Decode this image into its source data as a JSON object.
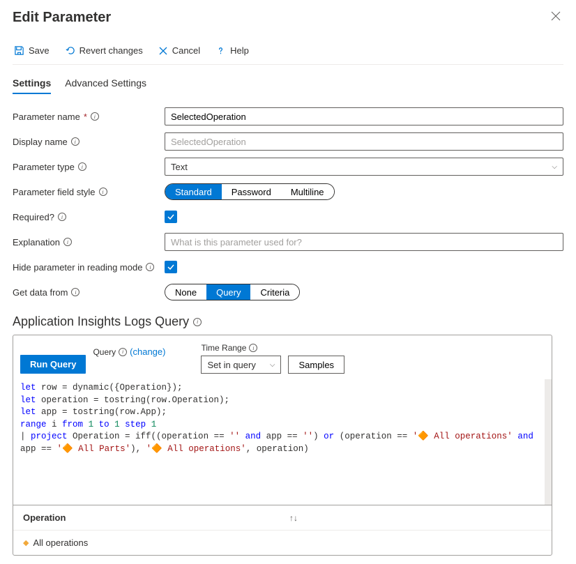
{
  "header": {
    "title": "Edit Parameter"
  },
  "toolbar": {
    "save": "Save",
    "revert": "Revert changes",
    "cancel": "Cancel",
    "help": "Help"
  },
  "tabs": {
    "settings": "Settings",
    "advanced": "Advanced Settings"
  },
  "form": {
    "paramName": {
      "label": "Parameter name",
      "value": "SelectedOperation"
    },
    "displayName": {
      "label": "Display name",
      "placeholder": "SelectedOperation"
    },
    "paramType": {
      "label": "Parameter type",
      "value": "Text"
    },
    "fieldStyle": {
      "label": "Parameter field style",
      "options": [
        "Standard",
        "Password",
        "Multiline"
      ]
    },
    "required": {
      "label": "Required?"
    },
    "explanation": {
      "label": "Explanation",
      "placeholder": "What is this parameter used for?"
    },
    "hideParam": {
      "label": "Hide parameter in reading mode"
    },
    "getData": {
      "label": "Get data from",
      "options": [
        "None",
        "Query",
        "Criteria"
      ]
    }
  },
  "querySection": {
    "title": "Application Insights Logs Query",
    "queryLabel": "Query",
    "changeLink": "(change)",
    "timeRangeLabel": "Time Range",
    "timeRangeValue": "Set in query",
    "runButton": "Run Query",
    "samplesButton": "Samples"
  },
  "code": {
    "l1a": "let",
    "l1b": " row = dynamic({Operation});",
    "l2a": "let",
    "l2b": " operation = tostring(row.Operation);",
    "l3a": "let",
    "l3b": " app = tostring(row.App);",
    "l4a": "range",
    "l4b": " i ",
    "l4c": "from",
    "l4d": "1",
    "l4e": "to",
    "l4f": "1",
    "l4g": "step",
    "l4h": "1",
    "l5a": "| ",
    "l5b": "project",
    "l5c": " Operation = iff((operation == ",
    "l5d": "''",
    "l5e": "and",
    "l5f": " app == ",
    "l5g": "''",
    "l5h": ") ",
    "l5i": "or",
    "l5j": " (operation == ",
    "l5k": "'🔶 All operations'",
    "l5l": "and",
    "l5m": " app == ",
    "l6a": "'🔶 All Parts'",
    "l6b": "), ",
    "l6c": "'🔶 All operations'",
    "l6d": ", operation)"
  },
  "results": {
    "column": "Operation",
    "row1": "All operations"
  }
}
